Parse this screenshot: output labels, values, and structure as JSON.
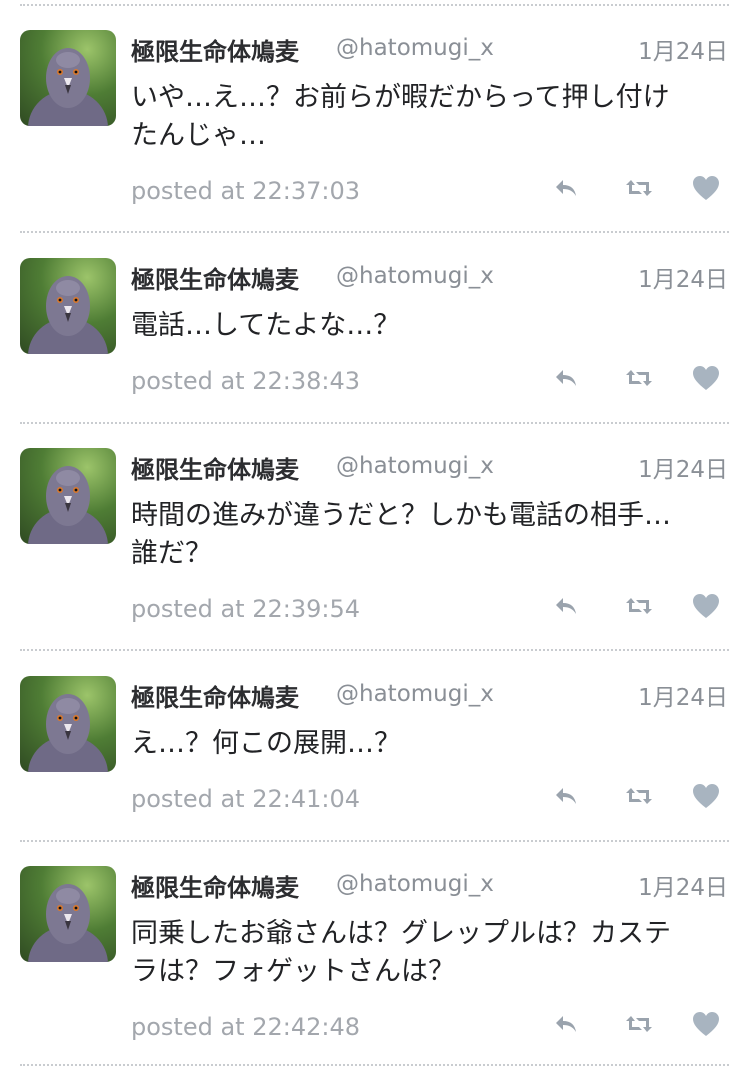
{
  "tweets": [
    {
      "name": "極限生命体鳩麦",
      "handle": "@hatomugi_x",
      "date": "1月24日",
      "line1": "いや…え…？お前らが暇だからって押し付け",
      "line2": "たんじゃ…",
      "posted": "posted at 22:37:03"
    },
    {
      "name": "極限生命体鳩麦",
      "handle": "@hatomugi_x",
      "date": "1月24日",
      "line1": "電話…してたよな…？",
      "line2": "",
      "posted": "posted at 22:38:43"
    },
    {
      "name": "極限生命体鳩麦",
      "handle": "@hatomugi_x",
      "date": "1月24日",
      "line1": "時間の進みが違うだと？しかも電話の相手…",
      "line2": "誰だ？",
      "posted": "posted at 22:39:54"
    },
    {
      "name": "極限生命体鳩麦",
      "handle": "@hatomugi_x",
      "date": "1月24日",
      "line1": "え…？何この展開…？",
      "line2": "",
      "posted": "posted at 22:41:04"
    },
    {
      "name": "極限生命体鳩麦",
      "handle": "@hatomugi_x",
      "date": "1月24日",
      "line1": "同乗したお爺さんは？グレップルは？カステ",
      "line2": "ラは？フォゲットさんは？",
      "posted": "posted at 22:42:48"
    }
  ],
  "icons": {
    "reply": "reply-icon",
    "retweet": "retweet-icon",
    "like": "heart-icon",
    "avatar": "pigeon-avatar"
  },
  "colors": {
    "name": "#2c2d30",
    "secondary": "#8a8f96",
    "meta": "#a3a7ad",
    "icon": "#9aa3ad",
    "like": "#a8b4c0",
    "divider": "#c9ccd0"
  }
}
